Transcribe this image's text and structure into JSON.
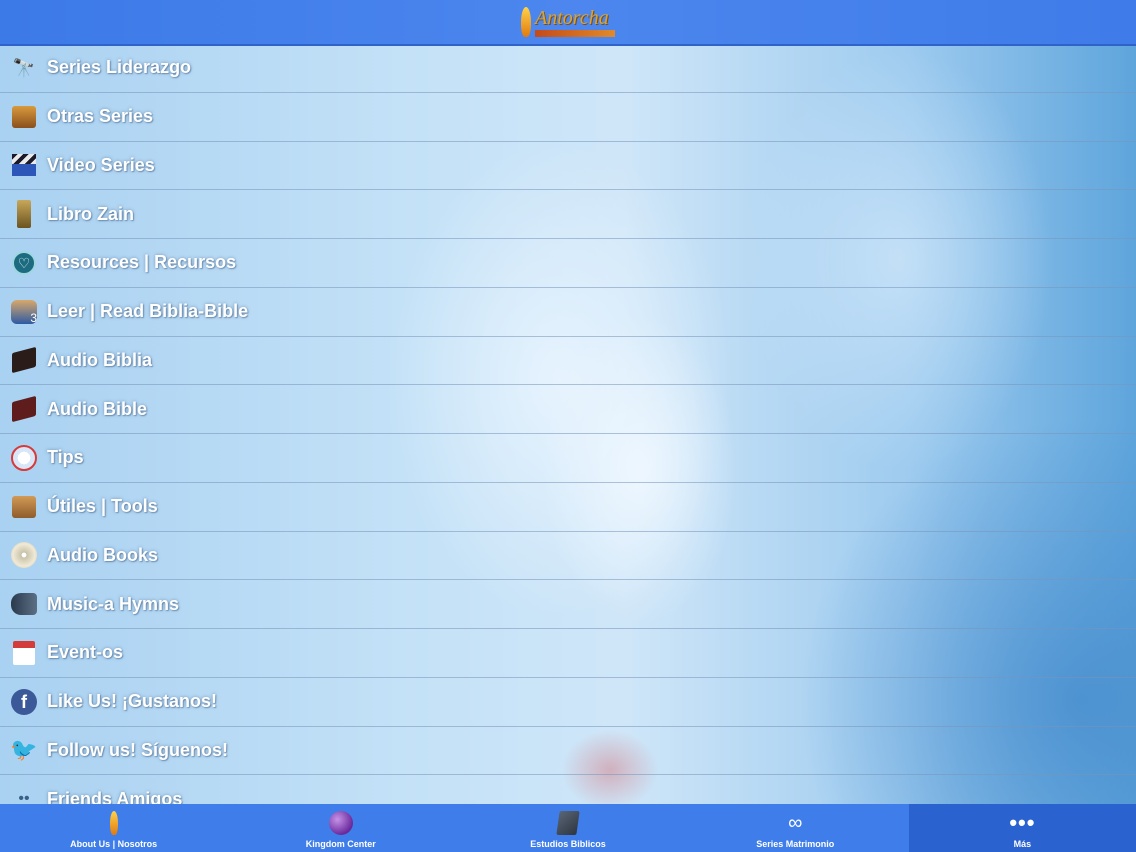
{
  "header": {
    "logo_text": "Antorcha",
    "logo_icon": "torch-flame-icon"
  },
  "menu": {
    "items": [
      {
        "label": "Series Liderazgo",
        "icon": "telescope-icon"
      },
      {
        "label": "Otras Series",
        "icon": "box-icon"
      },
      {
        "label": "Video Series",
        "icon": "clapperboard-icon"
      },
      {
        "label": "Libro Zain",
        "icon": "book-icon"
      },
      {
        "label": "Resources | Recursos",
        "icon": "heart-badge-icon"
      },
      {
        "label": "Leer | Read Biblia-Bible",
        "icon": "people-icon"
      },
      {
        "label": "Audio Biblia",
        "icon": "bible-icon"
      },
      {
        "label": "Audio Bible",
        "icon": "bible-red-icon"
      },
      {
        "label": "Tips",
        "icon": "tips-icon"
      },
      {
        "label": "Útiles | Tools",
        "icon": "toolbox-icon"
      },
      {
        "label": "Audio Books",
        "icon": "cd-icon"
      },
      {
        "label": "Music-a Hymns",
        "icon": "music-icon"
      },
      {
        "label": "Event-os",
        "icon": "calendar-icon"
      },
      {
        "label": "Like Us! ¡Gustanos!",
        "icon": "facebook-icon"
      },
      {
        "label": "Follow us! Síguenos!",
        "icon": "twitter-icon"
      },
      {
        "label": "Friends Amigos",
        "icon": "footprints-icon"
      }
    ]
  },
  "tabbar": {
    "tabs": [
      {
        "label": "About Us | Nosotros",
        "icon": "torch-icon",
        "active": false
      },
      {
        "label": "Kingdom Center",
        "icon": "globe-icon",
        "active": false
      },
      {
        "label": "Estudios Biblicos",
        "icon": "book-icon",
        "active": false
      },
      {
        "label": "Series Matrimonio",
        "icon": "rings-icon",
        "active": false
      },
      {
        "label": "Más",
        "icon": "more-dots-icon",
        "active": true
      }
    ]
  },
  "colors": {
    "header_bg": "#4c86ee",
    "tabbar_bg": "#3f7eea",
    "tab_active_bg": "#2a62cf",
    "label_text": "#ffffff"
  }
}
